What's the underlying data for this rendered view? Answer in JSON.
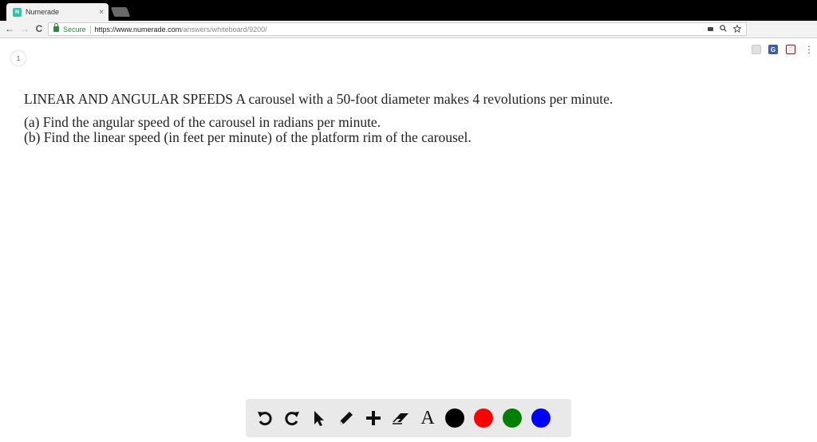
{
  "browser": {
    "tab": {
      "favicon_label": "N",
      "title": "Numerade",
      "close": "×"
    },
    "nav": {
      "back": "←",
      "forward": "→",
      "reload": "C"
    },
    "omnibox": {
      "secure_label": "Secure",
      "url_base": "https://www.numerade.com",
      "url_path": "/answers/whiteboard/9200/"
    },
    "extensions": {
      "g_label": "G",
      "pocket_label": "♡"
    },
    "menu": "⋮"
  },
  "page": {
    "page_number": "1",
    "problem": {
      "title": "LINEAR AND ANGULAR SPEEDS A carousel with a 50-foot diameter makes 4 revolutions per minute.",
      "part_a": "(a) Find the angular speed of the carousel in radians per minute.",
      "part_b": "(b) Find the linear speed (in feet per minute) of the platform rim of the carousel."
    }
  },
  "whiteboard_toolbar": {
    "tools": [
      "undo-icon",
      "redo-icon",
      "pointer-icon",
      "pencil-icon",
      "plus-icon",
      "eraser-icon",
      "text-icon"
    ],
    "text_tool_label": "A",
    "colors": [
      "#000000",
      "#ff0000",
      "#008000",
      "#0000ff"
    ]
  }
}
